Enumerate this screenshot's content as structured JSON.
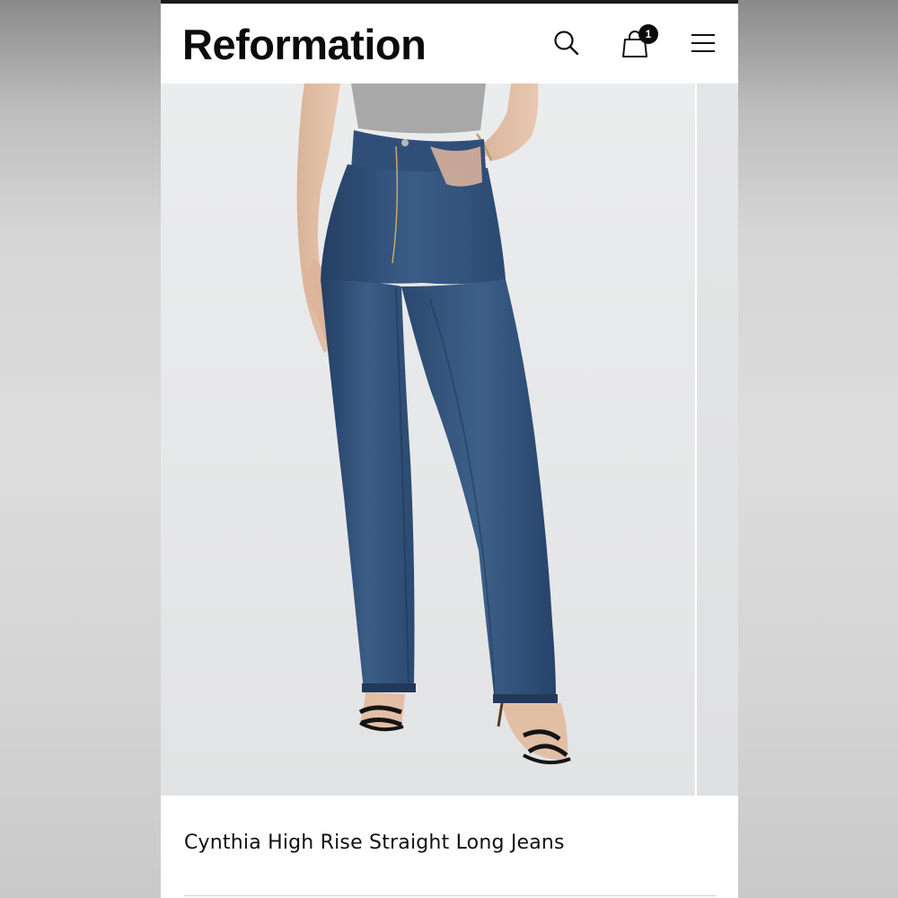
{
  "header": {
    "brand": "Reformation",
    "cart_count": "1",
    "icons": {
      "search": "search-icon",
      "cart": "shopping-bag-icon",
      "menu": "hamburger-menu-icon"
    }
  },
  "product": {
    "title": "Cynthia High Rise Straight Long Jeans",
    "image_subject": "model-wearing-jeans"
  },
  "colors": {
    "denim": "#2f4f78",
    "top": "#a9a9a9",
    "brand_text": "#0b0b0b"
  }
}
